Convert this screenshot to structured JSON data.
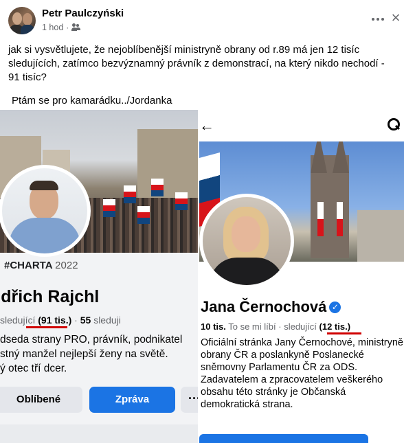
{
  "post": {
    "author": "Petr Paulczyński",
    "time": "1 hod",
    "separator": "·",
    "text": "jak si vysvětlujete, že nejoblíbenější ministryně obrany od r.89 má jen 12 tisíc sledujících, zatímco bezvýznamný právník z demonstrací, na který nikdo nechodí - 91 tisíc?",
    "text2": "Ptám se pro kamarádku../Jordanka"
  },
  "left_profile": {
    "hashtag": "#CHARTA",
    "hashtag_year": "2022",
    "name": "ndřich Rajchl",
    "followers_prefix": "sledující",
    "followers_count": "(91 tis.)",
    "dot": "·",
    "following_count": "55",
    "following_label": "sleduji",
    "bio_line1": "dseda strany PRO, právník, podnikatel",
    "bio_line2": "stný manžel nejlepší ženy na světě.",
    "bio_line3": "ý otec tří dcer.",
    "like_button": "Oblíbené",
    "message_button": "Zpráva",
    "more_button": "···"
  },
  "right_profile": {
    "back_icon": "←",
    "name": "Jana Černochová",
    "verified_icon": "✓",
    "likes_count": "10 tis.",
    "likes_label": "To se mi líbí",
    "dot": "·",
    "followers_label": "sledující",
    "followers_count": "(12 tis.)",
    "bio_p1": "Oficiální stránka Jany Černochové, ministryně obrany ČR a poslankyně Poslanecké sněmovny Parlamentu ČR za ODS.",
    "bio_p2": "Zadavatelem a zpracovatelem veškerého obsahu této stránky je Občanská demokratická strana."
  },
  "colors": {
    "accent": "#1b74e4",
    "underline": "#d00000",
    "flag_red": "#d7141a",
    "flag_blue": "#11457e"
  }
}
